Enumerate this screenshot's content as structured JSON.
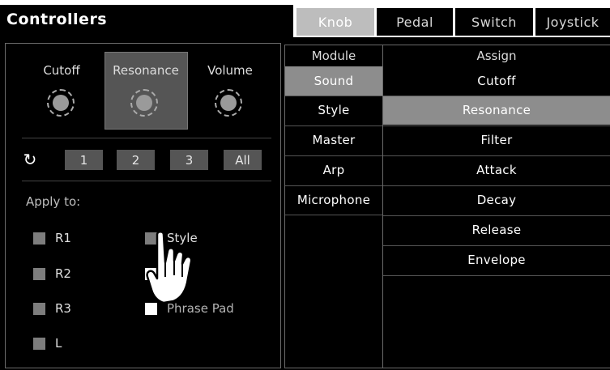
{
  "header": {
    "title": "Controllers",
    "tabs": [
      {
        "label": "Knob",
        "active": true
      },
      {
        "label": "Pedal",
        "active": false
      },
      {
        "label": "Switch",
        "active": false
      },
      {
        "label": "Joystick",
        "active": false
      }
    ]
  },
  "knobs": {
    "items": [
      {
        "label": "Cutoff",
        "selected": false
      },
      {
        "label": "Resonance",
        "selected": true
      },
      {
        "label": "Volume",
        "selected": false
      }
    ]
  },
  "presets": {
    "reset_icon": "refresh-icon",
    "buttons": [
      "1",
      "2",
      "3",
      "All"
    ]
  },
  "apply": {
    "label": "Apply to:",
    "parts": [
      {
        "label": "R1",
        "checked": false
      },
      {
        "label": "R2",
        "checked": false
      },
      {
        "label": "R3",
        "checked": false
      },
      {
        "label": "L",
        "checked": false
      }
    ],
    "targets": [
      {
        "label": "Style",
        "checked": false
      },
      {
        "label": "",
        "checked": true
      },
      {
        "label": "Phrase Pad",
        "checked": true
      }
    ]
  },
  "module": {
    "header": "Module",
    "items": [
      {
        "label": "Sound",
        "selected": true
      },
      {
        "label": "Style",
        "selected": false
      },
      {
        "label": "Master",
        "selected": false
      },
      {
        "label": "Arp",
        "selected": false
      },
      {
        "label": "Microphone",
        "selected": false
      }
    ]
  },
  "assign": {
    "header": "Assign",
    "items": [
      {
        "label": "Cutoff",
        "selected": false
      },
      {
        "label": "Resonance",
        "selected": true
      },
      {
        "label": "Filter",
        "selected": false
      },
      {
        "label": "Attack",
        "selected": false
      },
      {
        "label": "Decay",
        "selected": false
      },
      {
        "label": "Release",
        "selected": false
      },
      {
        "label": "Envelope",
        "selected": false
      }
    ]
  },
  "pointer_icon": "hand-pointer-icon"
}
